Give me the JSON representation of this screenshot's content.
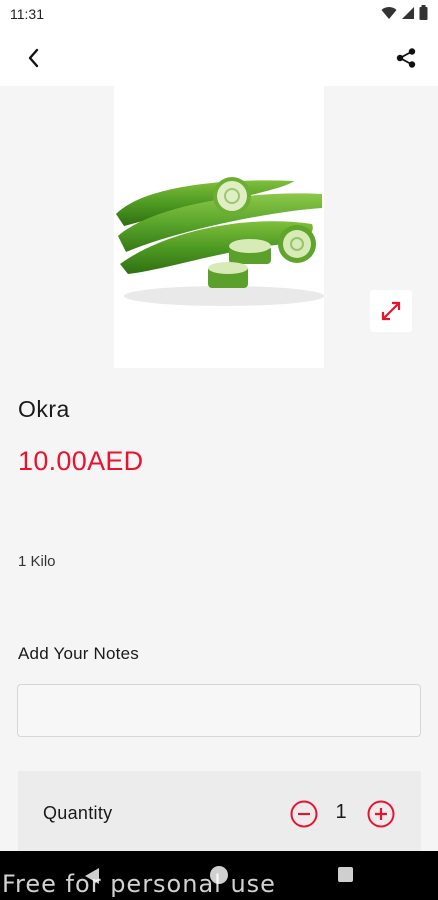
{
  "status_bar": {
    "time": "11:31",
    "icons": [
      "wifi-icon",
      "signal-icon",
      "battery-icon"
    ]
  },
  "app_bar": {
    "back_icon": "chevron-left-icon",
    "share_icon": "share-icon"
  },
  "product": {
    "image": "okra-photo",
    "expand_icon": "expand-icon",
    "name": "Okra",
    "price": "10.00AED",
    "unit": "1 Kilo"
  },
  "notes": {
    "label": "Add Your Notes",
    "value": "",
    "placeholder": ""
  },
  "quantity": {
    "label": "Quantity",
    "value": "1",
    "minus_icon": "minus-circle-icon",
    "plus_icon": "plus-circle-icon"
  },
  "nav_bar": {
    "icons": [
      "nav-back-icon",
      "nav-home-icon",
      "nav-recent-icon"
    ]
  },
  "watermark": "Free for personal use",
  "colors": {
    "accent": "#e8132f",
    "background": "#f5f5f5",
    "panel": "#ececec"
  }
}
